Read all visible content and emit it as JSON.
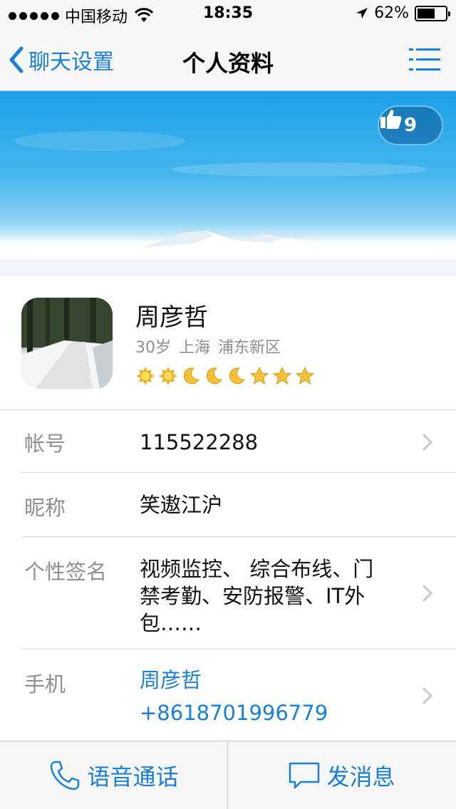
{
  "status_bar": {
    "carrier": "中国移动",
    "time": "18:35",
    "battery_text": "62%",
    "battery_level": 0.62
  },
  "nav": {
    "back_label": "聊天设置",
    "title": "个人资料"
  },
  "cover": {
    "like_count": "9"
  },
  "profile": {
    "name": "周彦哲",
    "info": "30岁 上海 浦东新区",
    "level_icons": [
      "sun-icon",
      "sun-icon",
      "moon-icon",
      "moon-icon",
      "moon-icon",
      "star-icon",
      "star-icon",
      "star-icon"
    ]
  },
  "rows": {
    "account": {
      "label": "帐号",
      "value": "115522288"
    },
    "nickname": {
      "label": "昵称",
      "value": "笑遨江沪"
    },
    "signature": {
      "label": "个性签名",
      "line1": "视频监控、 综合布线、门",
      "line2": "禁考勤、安防报警、IT外",
      "line3": "包……"
    },
    "phone": {
      "label": "手机",
      "name": "周彦哲",
      "number": "+8618701996779"
    }
  },
  "bottom": {
    "call_label": "语音通话",
    "message_label": "发消息"
  },
  "colors": {
    "accent": "#1a7fd9",
    "secondary_text": "#8e8e93",
    "sun": "#f2b01e",
    "moon": "#f4c23a"
  }
}
